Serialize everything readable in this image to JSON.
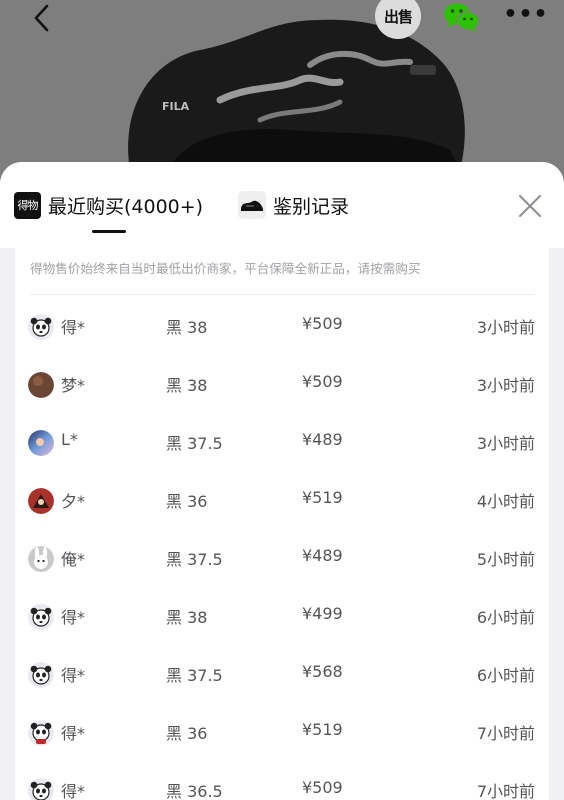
{
  "header": {
    "sell_label": "出售"
  },
  "tabs": {
    "recent_logo": "得物",
    "recent_label": "最近购买(4000+)",
    "auth_label": "鉴别记录"
  },
  "notice": "得物售价始终来自当时最低出价商家，平台保障全新正品，请按需购买",
  "records": [
    {
      "name": "得*",
      "spec": "黑 38",
      "price": "¥509",
      "time": "3小时前",
      "avatar": "panda"
    },
    {
      "name": "梦*",
      "spec": "黑 38",
      "price": "¥509",
      "time": "3小时前",
      "avatar": "brown"
    },
    {
      "name": "L*",
      "spec": "黑 37.5",
      "price": "¥489",
      "time": "3小时前",
      "avatar": "galaxy"
    },
    {
      "name": "夕*",
      "spec": "黑 36",
      "price": "¥519",
      "time": "4小时前",
      "avatar": "red"
    },
    {
      "name": "俺*",
      "spec": "黑 37.5",
      "price": "¥489",
      "time": "5小时前",
      "avatar": "rabbit"
    },
    {
      "name": "得*",
      "spec": "黑 38",
      "price": "¥499",
      "time": "6小时前",
      "avatar": "panda"
    },
    {
      "name": "得*",
      "spec": "黑 37.5",
      "price": "¥568",
      "time": "6小时前",
      "avatar": "panda"
    },
    {
      "name": "得*",
      "spec": "黑 36",
      "price": "¥519",
      "time": "7小时前",
      "avatar": "panda-red"
    },
    {
      "name": "得*",
      "spec": "黑 36.5",
      "price": "¥509",
      "time": "7小时前",
      "avatar": "panda"
    }
  ],
  "icons": {
    "back": "chevron-left-icon",
    "share": "wechat-icon",
    "more": "more-icon",
    "close": "close-icon"
  },
  "colors": {
    "text_primary": "#111111",
    "text_secondary": "#555558",
    "text_muted": "#a1a1a6",
    "wechat_green": "#2dc100"
  }
}
